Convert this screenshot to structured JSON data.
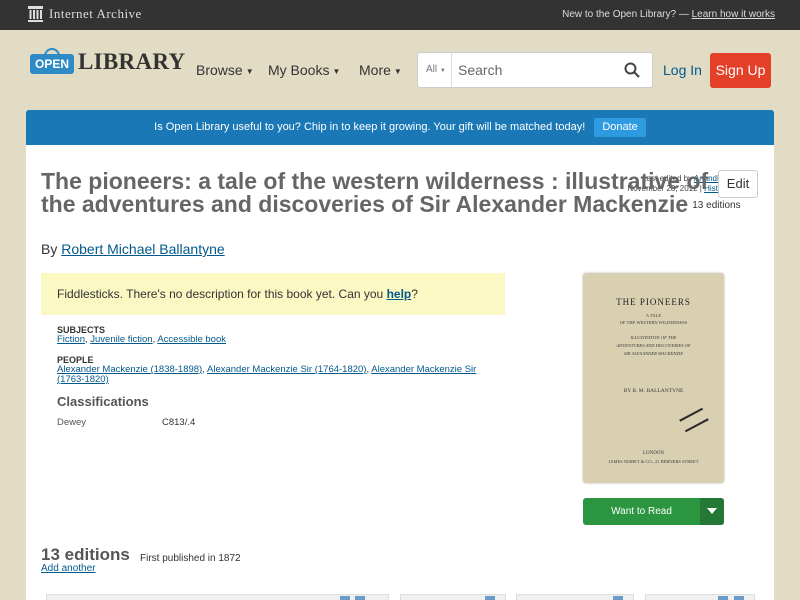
{
  "ia_bar": {
    "logo_text": "Internet Archive",
    "prompt": "New to the Open Library?",
    "link": "Learn how it works"
  },
  "header": {
    "logo_badge": "OPEN",
    "logo_word": "LIBRARY",
    "nav": [
      "Browse",
      "My Books",
      "More"
    ],
    "search_scope": "All",
    "search_placeholder": "Search",
    "login": "Log In",
    "signup": "Sign Up"
  },
  "banner": {
    "text": "Is Open Library useful to you? Chip in to keep it growing. Your gift will be matched today!",
    "button": "Donate"
  },
  "book": {
    "edited_prefix": "Last edited by",
    "edited_by": "AnandBot",
    "edited_date": "November 28, 2012",
    "history": "History",
    "edit": "Edit",
    "title": "The pioneers: a tale of the western wilderness : illustrative of the adventures and discoveries of Sir Alexander Mackenzie",
    "editions_count": "13 editions",
    "by": "By",
    "author": "Robert Michael Ballantyne",
    "no_desc_text": "Fiddlesticks. There's no description for this book yet. Can you",
    "no_desc_link": "help",
    "no_desc_end": "?",
    "subjects_label": "SUBJECTS",
    "subjects": [
      "Fiction",
      "Juvenile fiction",
      "Accessible book"
    ],
    "people_label": "PEOPLE",
    "people": [
      "Alexander Mackenzie (1838-1898)",
      "Alexander Mackenzie Sir (1764-1820)",
      "Alexander Mackenzie Sir (1763-1820)"
    ],
    "classifications_label": "Classifications",
    "dewey_key": "Dewey",
    "dewey_value": "C813/.4",
    "want_to_read": "Want to Read"
  },
  "cover": {
    "title": "THE PIONEERS",
    "line1": "A TALE",
    "line2": "OF THE WESTERN WILDERNESS",
    "line3": "ILLUSTRATIVE OF THE",
    "line4": "ADVENTURES AND DISCOVERIES OF",
    "line5": "SIR ALEXANDER MACKENZIE",
    "author": "BY R. M. BALLANTYNE",
    "place": "LONDON",
    "publisher": "JAMES NISBET & CO., 21 BERNERS STREET"
  },
  "editions": {
    "heading": "13 editions",
    "first_published": "First published in 1872",
    "add_another": "Add another"
  },
  "colors": {
    "accent": "#02598b",
    "signup": "#e44028",
    "banner": "#1a78b6",
    "want": "#2b9540"
  }
}
